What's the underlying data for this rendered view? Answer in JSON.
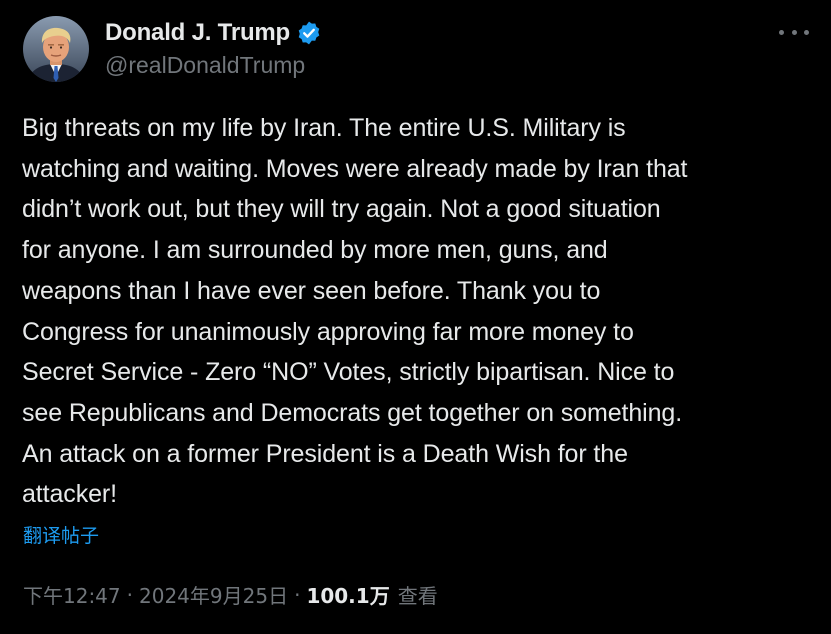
{
  "author": {
    "display_name": "Donald J. Trump",
    "handle": "@realDonaldTrump",
    "verified": true
  },
  "tweet": {
    "text": "Big threats on my life by Iran. The entire U.S. Military is\nwatching and waiting. Moves were already made by Iran that\ndidn’t work out, but they will try again. Not a good situation\nfor anyone. I am surrounded by more men, guns, and\nweapons than I have ever seen before. Thank you to\nCongress for unanimously approving far more money to\nSecret Service - Zero “NO” Votes, strictly bipartisan. Nice to\nsee Republicans and Democrats get together on something.\nAn attack on a former President is a Death Wish for the\nattacker!",
    "translate_label": "翻译帖子"
  },
  "meta": {
    "time": "下午12:47",
    "separator": "·",
    "date": "2024年9月25日",
    "views_count": "100.1万",
    "views_label": "查看"
  },
  "icons": {
    "verified": "verified-badge-icon",
    "more": "more-options-icon"
  },
  "colors": {
    "background": "#000000",
    "text": "#e7e9ea",
    "secondary": "#71767b",
    "accent": "#1d9bf0"
  }
}
